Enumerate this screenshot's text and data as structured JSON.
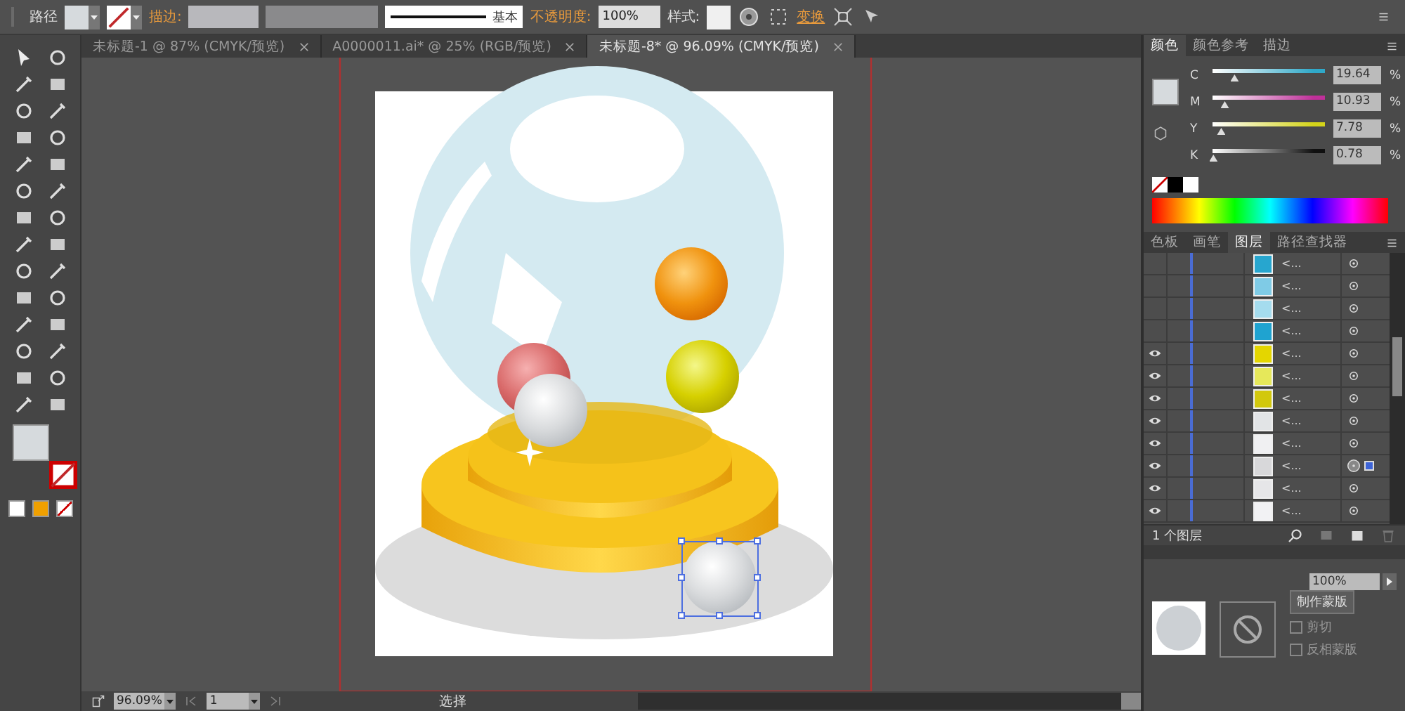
{
  "control_bar": {
    "selection": "路径",
    "stroke_label": "描边:",
    "stroke_style": "基本",
    "opacity_label": "不透明度:",
    "opacity": "100%",
    "style_label": "样式:",
    "transform": "变换"
  },
  "tabs": [
    {
      "label": "未标题-1 @ 87% (CMYK/预览)",
      "selected": false
    },
    {
      "label": "A0000011.ai* @ 25% (RGB/预览)",
      "selected": false
    },
    {
      "label": "未标题-8* @ 96.09% (CMYK/预览)",
      "selected": true
    }
  ],
  "color_panel": {
    "tabs": [
      {
        "label": "颜色",
        "selected": true
      },
      {
        "label": "颜色参考",
        "selected": false
      },
      {
        "label": "描边",
        "selected": false
      }
    ],
    "sliders": [
      {
        "channel": "C",
        "level": 0.196,
        "value": "19.64",
        "unit": "%",
        "color": "#2fa8c8"
      },
      {
        "channel": "M",
        "level": 0.109,
        "value": "10.93",
        "unit": "%",
        "color": "#c0309a"
      },
      {
        "channel": "Y",
        "level": 0.078,
        "value": "7.78",
        "unit": "%",
        "color": "#d4d41a"
      },
      {
        "channel": "K",
        "level": 0.008,
        "value": "0.78",
        "unit": "%",
        "color": "#101010"
      }
    ]
  },
  "layers_panel": {
    "tabs": [
      {
        "label": "色板",
        "selected": false
      },
      {
        "label": "画笔",
        "selected": false
      },
      {
        "label": "图层",
        "selected": true
      },
      {
        "label": "路径查找器",
        "selected": false
      }
    ],
    "rows": [
      {
        "visible": false,
        "color": "#27a6cf",
        "name": "<...",
        "targeted": false
      },
      {
        "visible": false,
        "color": "#7fcbe6",
        "name": "<...",
        "targeted": false
      },
      {
        "visible": false,
        "color": "#a5dcee",
        "name": "<...",
        "targeted": false
      },
      {
        "visible": false,
        "color": "#1fa3d0",
        "name": "<...",
        "targeted": false
      },
      {
        "visible": true,
        "color": "#e4d600",
        "name": "<...",
        "targeted": false
      },
      {
        "visible": true,
        "color": "#e6e85a",
        "name": "<...",
        "targeted": false
      },
      {
        "visible": true,
        "color": "#d2c80c",
        "name": "<...",
        "targeted": false
      },
      {
        "visible": true,
        "color": "#e2e4e6",
        "name": "<...",
        "targeted": false
      },
      {
        "visible": true,
        "color": "#f0f0f2",
        "name": "<...",
        "targeted": false
      },
      {
        "visible": true,
        "color": "#d8d8da",
        "name": "<...",
        "targeted": true
      },
      {
        "visible": true,
        "color": "#e6e6e8",
        "name": "<...",
        "targeted": false
      },
      {
        "visible": true,
        "color": "#f2f2f4",
        "name": "<...",
        "targeted": false
      }
    ],
    "footer": "1 个图层"
  },
  "transparency_panel": {
    "opacity": "100%",
    "make_mask": "制作蒙版",
    "clip": {
      "label": "剪切",
      "checked": false
    },
    "invert_mask": {
      "label": "反相蒙版",
      "checked": false
    }
  },
  "status_bar": {
    "zoom": "96.09%",
    "page": "1",
    "tool": "选择"
  }
}
